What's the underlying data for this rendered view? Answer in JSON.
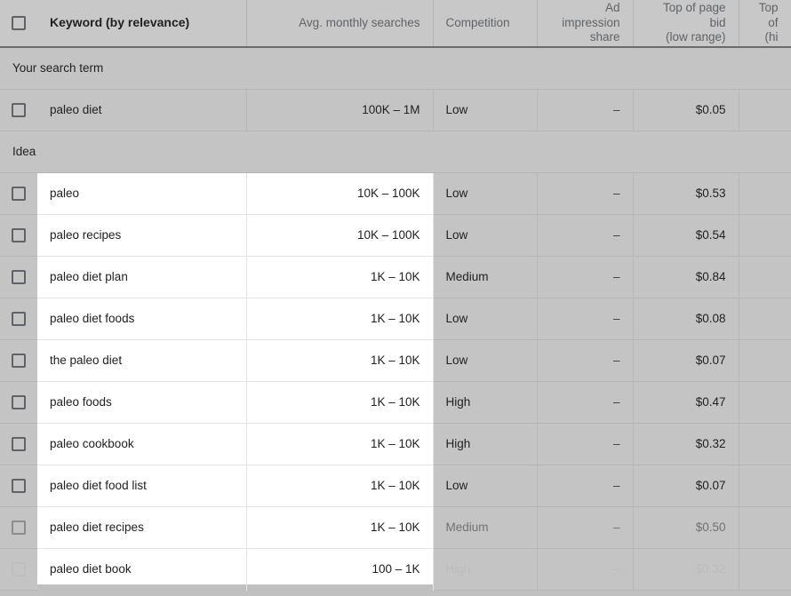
{
  "table": {
    "columns": [
      {
        "id": "checkbox",
        "label": "",
        "align": "center"
      },
      {
        "id": "keyword",
        "label": "Keyword (by relevance)",
        "align": "left"
      },
      {
        "id": "avg_monthly_searches",
        "label": "Avg. monthly searches",
        "align": "right"
      },
      {
        "id": "competition",
        "label": "Competition",
        "align": "left"
      },
      {
        "id": "ad_impression_share",
        "label": "Ad impression\nshare",
        "label_line1": "Ad impression",
        "label_line2": "share",
        "align": "right"
      },
      {
        "id": "top_of_page_bid_low",
        "label": "Top of page bid\n(low range)",
        "label_line1": "Top of page bid",
        "label_line2": "(low range)",
        "align": "right"
      },
      {
        "id": "top_of_page_bid_high",
        "label": "Top of\n(hi",
        "label_line1": "Top of",
        "label_line2": "(hi",
        "align": "right",
        "truncated": true
      }
    ],
    "sections": [
      {
        "id": "your-search-term",
        "label": "Your search term"
      },
      {
        "id": "idea",
        "label": "Idea"
      }
    ],
    "search_term_rows": [
      {
        "keyword": "paleo diet",
        "avg_monthly_searches": "100K – 1M",
        "competition": "Low",
        "ad_impression_share": "–",
        "top_of_page_bid_low": "$0.05",
        "top_of_page_bid_high": ""
      }
    ],
    "idea_rows": [
      {
        "keyword": "paleo",
        "avg_monthly_searches": "10K – 100K",
        "competition": "Low",
        "ad_impression_share": "–",
        "top_of_page_bid_low": "$0.53",
        "top_of_page_bid_high": "",
        "fade": 0
      },
      {
        "keyword": "paleo recipes",
        "avg_monthly_searches": "10K – 100K",
        "competition": "Low",
        "ad_impression_share": "–",
        "top_of_page_bid_low": "$0.54",
        "top_of_page_bid_high": "",
        "fade": 0
      },
      {
        "keyword": "paleo diet plan",
        "avg_monthly_searches": "1K – 10K",
        "competition": "Medium",
        "ad_impression_share": "–",
        "top_of_page_bid_low": "$0.84",
        "top_of_page_bid_high": "",
        "fade": 0
      },
      {
        "keyword": "paleo diet foods",
        "avg_monthly_searches": "1K – 10K",
        "competition": "Low",
        "ad_impression_share": "–",
        "top_of_page_bid_low": "$0.08",
        "top_of_page_bid_high": "",
        "fade": 0
      },
      {
        "keyword": "the paleo diet",
        "avg_monthly_searches": "1K – 10K",
        "competition": "Low",
        "ad_impression_share": "–",
        "top_of_page_bid_low": "$0.07",
        "top_of_page_bid_high": "",
        "fade": 0
      },
      {
        "keyword": "paleo foods",
        "avg_monthly_searches": "1K – 10K",
        "competition": "High",
        "ad_impression_share": "–",
        "top_of_page_bid_low": "$0.47",
        "top_of_page_bid_high": "",
        "fade": 0
      },
      {
        "keyword": "paleo cookbook",
        "avg_monthly_searches": "1K – 10K",
        "competition": "High",
        "ad_impression_share": "–",
        "top_of_page_bid_low": "$0.32",
        "top_of_page_bid_high": "",
        "fade": 0
      },
      {
        "keyword": "paleo diet food list",
        "avg_monthly_searches": "1K – 10K",
        "competition": "Low",
        "ad_impression_share": "–",
        "top_of_page_bid_low": "$0.07",
        "top_of_page_bid_high": "",
        "fade": 0
      },
      {
        "keyword": "paleo diet recipes",
        "avg_monthly_searches": "1K – 10K",
        "competition": "Medium",
        "ad_impression_share": "–",
        "top_of_page_bid_low": "$0.50",
        "top_of_page_bid_high": "",
        "fade": 1
      },
      {
        "keyword": "paleo diet book",
        "avg_monthly_searches": "100 – 1K",
        "competition": "High",
        "ad_impression_share": "–",
        "top_of_page_bid_low": "$0.32",
        "top_of_page_bid_high": "",
        "fade": 2
      }
    ]
  },
  "colors": {
    "page_background": "#c0c0c0",
    "header_background": "#c8c8c8",
    "row_background": "#c4c4c4",
    "spotlight_background": "#ffffff",
    "text_primary": "#202124",
    "text_secondary": "#5f6368",
    "grid_line": "#b6b6b6",
    "header_underline": "#6b6b6b"
  }
}
